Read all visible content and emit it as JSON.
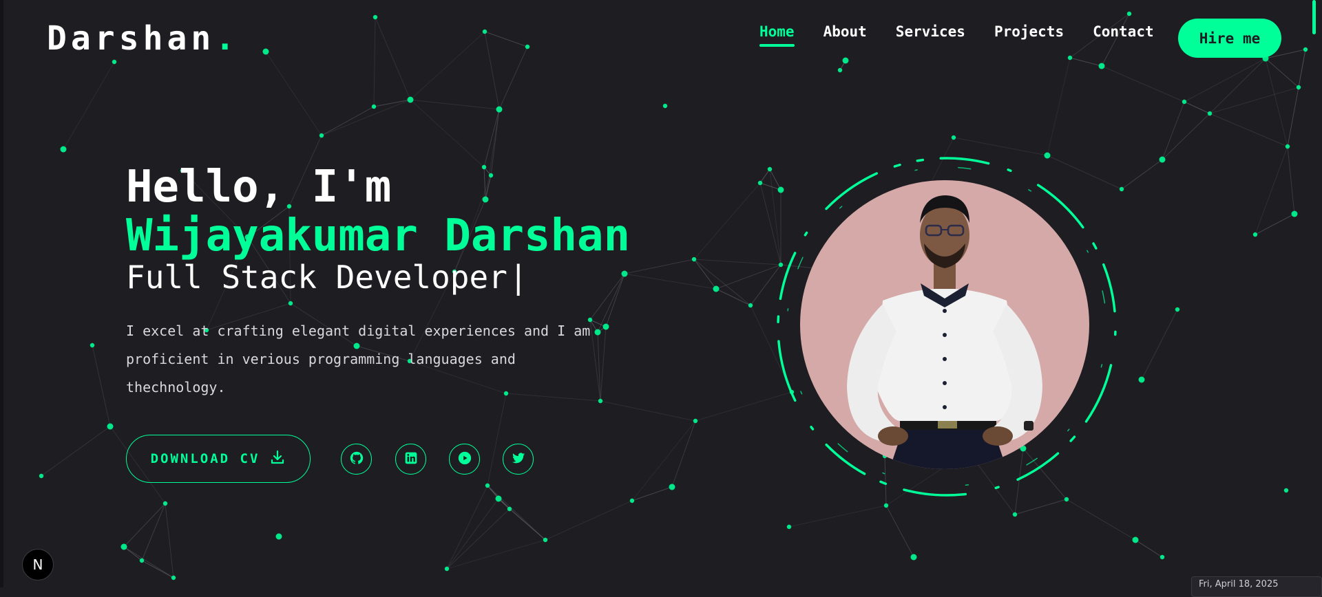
{
  "header": {
    "logo_text": "Darshan",
    "logo_dot": ".",
    "nav": [
      {
        "label": "Home",
        "active": true
      },
      {
        "label": "About",
        "active": false
      },
      {
        "label": "Services",
        "active": false
      },
      {
        "label": "Projects",
        "active": false
      },
      {
        "label": "Contact",
        "active": false
      }
    ],
    "hire_label": "Hire me"
  },
  "hero": {
    "greeting": "Hello, I'm",
    "name": "Wijayakumar Darshan",
    "role": "Full Stack Developer",
    "caret": "|",
    "description": "I excel at crafting elegant digital experiences and I am proficient in verious programming languages and thechnology.",
    "download_label": "DOWNLOAD CV",
    "download_icon": "download-icon",
    "socials": [
      {
        "name": "github",
        "icon": "github-icon"
      },
      {
        "name": "linkedin",
        "icon": "linkedin-icon"
      },
      {
        "name": "youtube",
        "icon": "youtube-icon"
      },
      {
        "name": "twitter",
        "icon": "twitter-icon"
      }
    ]
  },
  "portrait": {
    "alt": "profile photo",
    "background": "#d4a9a7"
  },
  "overlay": {
    "framework_badge": "N",
    "date_tooltip": "Fri, April 18, 2025"
  },
  "theme": {
    "accent": "#00ff99",
    "background": "#1e1d22",
    "text": "#ffffff"
  }
}
